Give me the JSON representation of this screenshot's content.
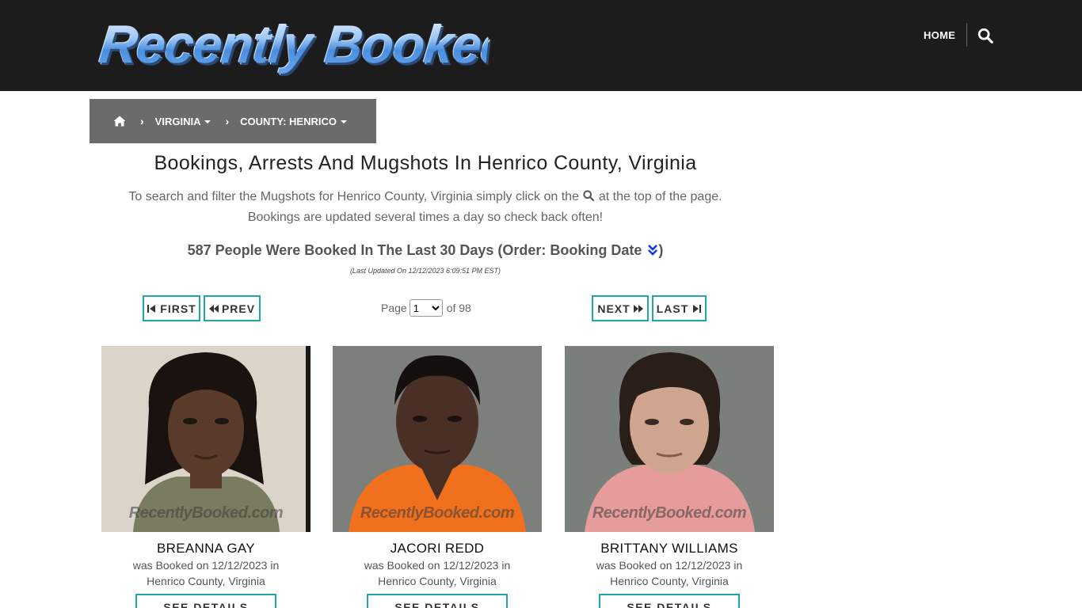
{
  "header": {
    "logo_text": "Recently Booked",
    "nav_home": "HOME",
    "search_icon": "search-icon"
  },
  "breadcrumb": {
    "home_icon": "home-icon",
    "items": [
      {
        "label": "VIRGINIA"
      },
      {
        "label": "COUNTY: HENRICO"
      }
    ]
  },
  "main": {
    "title": "Bookings, Arrests And Mugshots In Henrico County, Virginia",
    "intro_part1": "To search and filter the Mugshots for Henrico County, Virginia simply click on the",
    "intro_part2": "at the top of the page.",
    "intro_line2": "Bookings are updated several times a day so check back often!",
    "count_text": "587 People Were Booked In The Last 30 Days (Order: Booking Date",
    "count_close": ")",
    "updated": "(Last Updated On 12/12/2023 6:09:51 PM EST)"
  },
  "pagination": {
    "first": "FIRST",
    "prev": "PREV",
    "next": "NEXT",
    "last": "LAST",
    "page_label": "Page",
    "current_page": "1",
    "of_label": "of 98"
  },
  "cards": [
    {
      "name": "BREANNA GAY",
      "line1": "was Booked on 12/12/2023 in",
      "line2": "Henrico County, Virginia",
      "watermark": "RecentlyBooked.com",
      "button": "SEE DETAILS",
      "bg": "#dcd3ca",
      "shirt": "#7a7c60",
      "skin": "#5a3b2a",
      "hair": "#1a120e"
    },
    {
      "name": "JACORI REDD",
      "line1": "was Booked on 12/12/2023 in",
      "line2": "Henrico County, Virginia",
      "watermark": "RecentlyBooked.com",
      "button": "SEE DETAILS",
      "bg": "#7d7f7a",
      "shirt": "#f0701e",
      "skin": "#4a3024",
      "hair": "#141010"
    },
    {
      "name": "BRITTANY WILLIAMS",
      "line1": "was Booked on 12/12/2023 in",
      "line2": "Henrico County, Virginia",
      "watermark": "RecentlyBooked.com",
      "button": "SEE DETAILS",
      "bg": "#7b7f7c",
      "shirt": "#e59c9a",
      "skin": "#cfa58f",
      "hair": "#2a1e18"
    }
  ]
}
